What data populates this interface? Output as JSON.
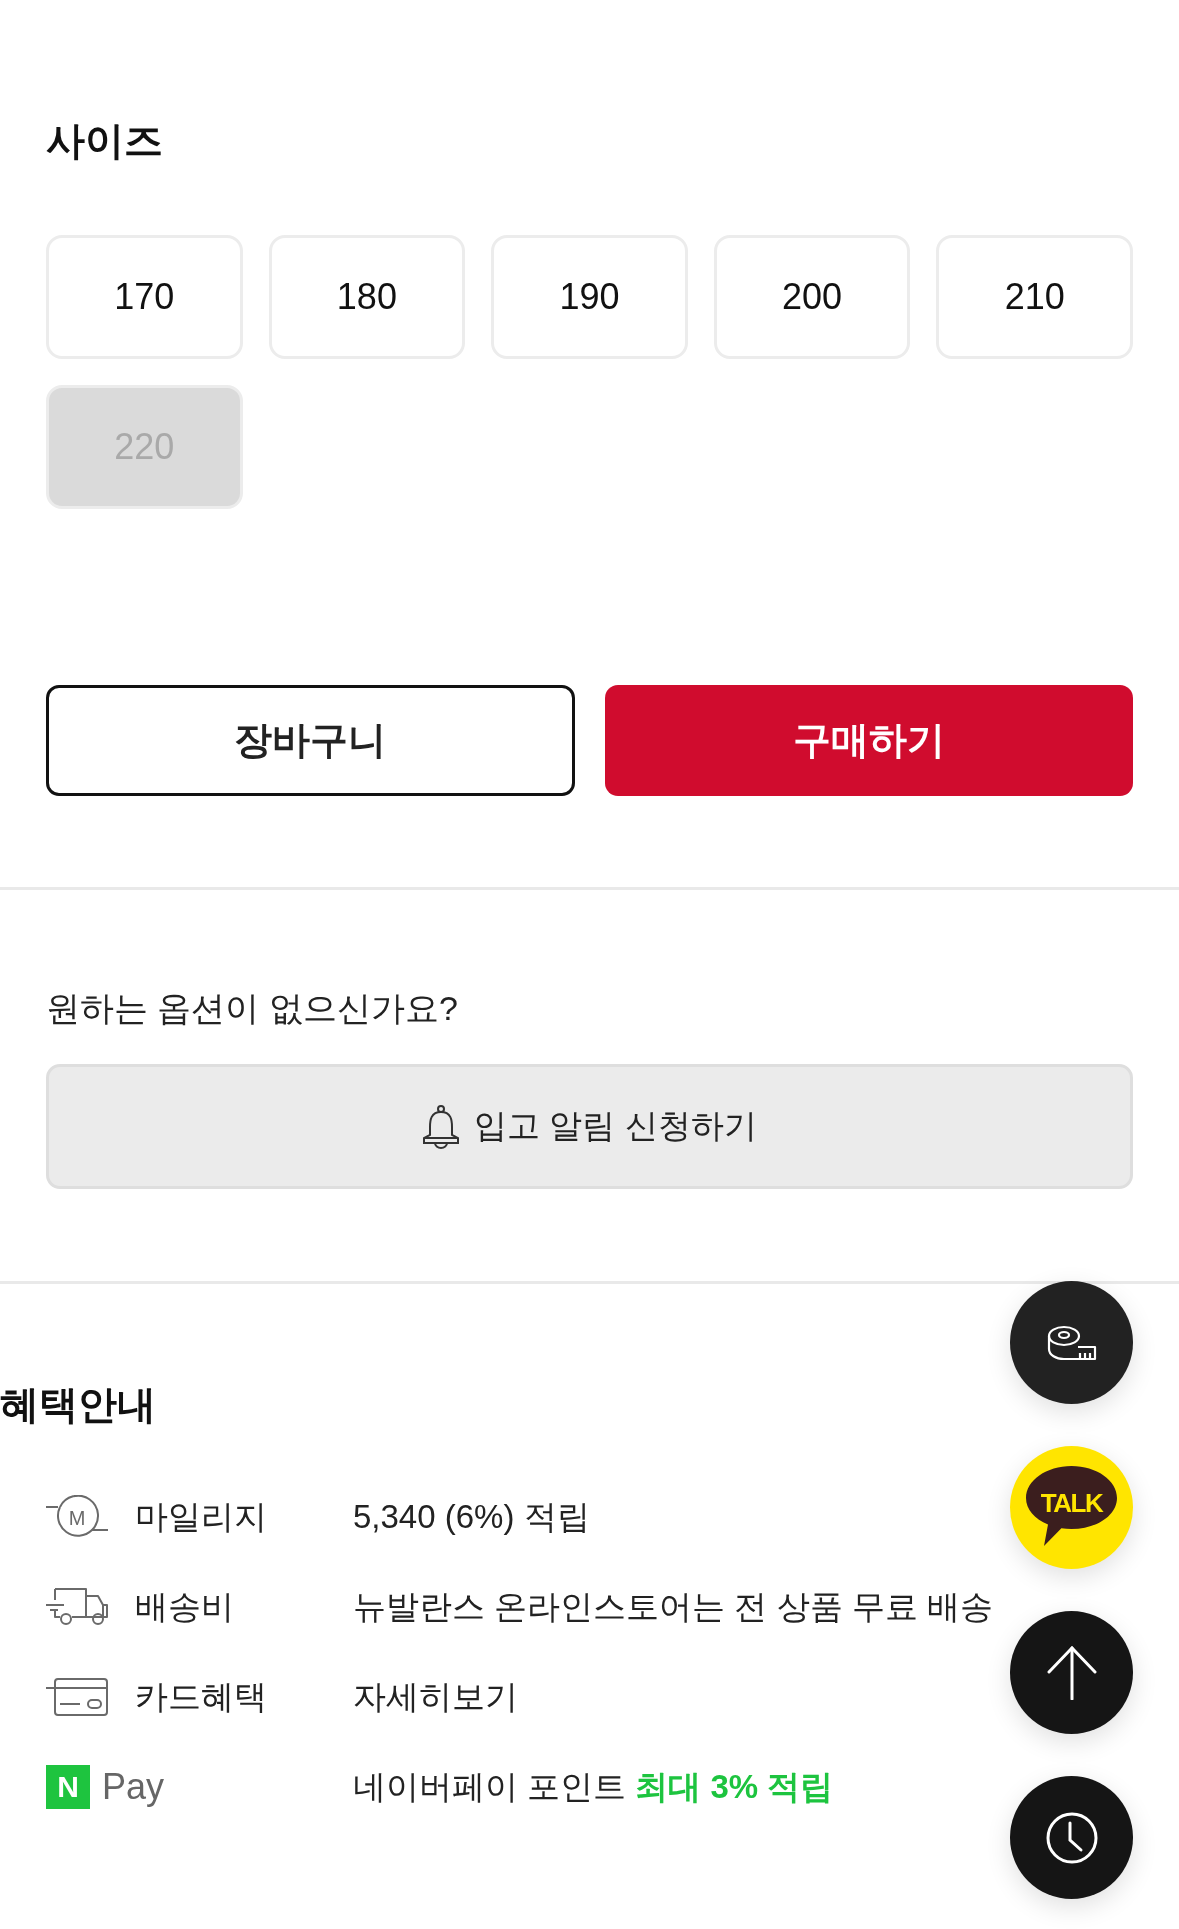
{
  "size_section": {
    "title": "사이즈",
    "options": [
      {
        "label": "170",
        "disabled": false
      },
      {
        "label": "180",
        "disabled": false
      },
      {
        "label": "190",
        "disabled": false
      },
      {
        "label": "200",
        "disabled": false
      },
      {
        "label": "210",
        "disabled": false
      },
      {
        "label": "220",
        "disabled": true
      }
    ]
  },
  "actions": {
    "cart_button": "장바구니",
    "buy_button": "구매하기"
  },
  "restock": {
    "question": "원하는 옵션이 없으신가요?",
    "button": "입고 알림 신청하기"
  },
  "benefits": {
    "title": "혜택안내",
    "items": [
      {
        "kind": "mileage",
        "icon_text": "M",
        "label": "마일리지",
        "value": "5,340 (6%) 적립"
      },
      {
        "kind": "shipping",
        "label": "배송비",
        "value": "뉴발란스 온라인스토어는 전 상품 무료 배송"
      },
      {
        "kind": "card",
        "label": "카드혜택",
        "value": "자세히보기"
      },
      {
        "kind": "npay",
        "badge": "N",
        "label": "Pay",
        "value": "네이버페이 포인트 **최대 3% 적립**"
      }
    ]
  },
  "floating_buttons": [
    {
      "kind": "size_guide"
    },
    {
      "kind": "talk",
      "label": "TALK"
    },
    {
      "kind": "top"
    },
    {
      "kind": "recent"
    }
  ]
}
